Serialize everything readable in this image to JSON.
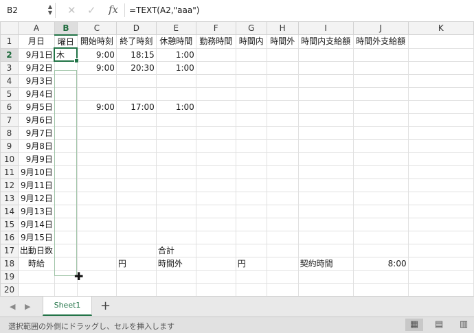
{
  "formula_bar": {
    "name_box": "B2",
    "cancel_icon": "close-icon",
    "enter_icon": "check-icon",
    "fx_label": "fx",
    "formula": "=TEXT(A2,\"aaa\")"
  },
  "columns": [
    "A",
    "B",
    "C",
    "D",
    "E",
    "F",
    "G",
    "H",
    "I",
    "J",
    "K"
  ],
  "selected_column": "B",
  "active_cell": "B2",
  "rows": [
    {
      "n": "1",
      "cells": [
        "月日",
        "曜日",
        "開始時刻",
        "終了時刻",
        "休憩時間",
        "勤務時間",
        "時間内",
        "時間外",
        "時間内支給額",
        "時間外支給額",
        ""
      ]
    },
    {
      "n": "2",
      "cells": [
        "9月1日",
        "木",
        "9:00",
        "18:15",
        "1:00",
        "",
        "",
        "",
        "",
        "",
        ""
      ]
    },
    {
      "n": "3",
      "cells": [
        "9月2日",
        "",
        "9:00",
        "20:30",
        "1:00",
        "",
        "",
        "",
        "",
        "",
        ""
      ]
    },
    {
      "n": "4",
      "cells": [
        "9月3日",
        "",
        "",
        "",
        "",
        "",
        "",
        "",
        "",
        "",
        ""
      ]
    },
    {
      "n": "5",
      "cells": [
        "9月4日",
        "",
        "",
        "",
        "",
        "",
        "",
        "",
        "",
        "",
        ""
      ]
    },
    {
      "n": "6",
      "cells": [
        "9月5日",
        "",
        "9:00",
        "17:00",
        "1:00",
        "",
        "",
        "",
        "",
        "",
        ""
      ]
    },
    {
      "n": "7",
      "cells": [
        "9月6日",
        "",
        "",
        "",
        "",
        "",
        "",
        "",
        "",
        "",
        ""
      ]
    },
    {
      "n": "8",
      "cells": [
        "9月7日",
        "",
        "",
        "",
        "",
        "",
        "",
        "",
        "",
        "",
        ""
      ]
    },
    {
      "n": "9",
      "cells": [
        "9月8日",
        "",
        "",
        "",
        "",
        "",
        "",
        "",
        "",
        "",
        ""
      ]
    },
    {
      "n": "10",
      "cells": [
        "9月9日",
        "",
        "",
        "",
        "",
        "",
        "",
        "",
        "",
        "",
        ""
      ]
    },
    {
      "n": "11",
      "cells": [
        "9月10日",
        "",
        "",
        "",
        "",
        "",
        "",
        "",
        "",
        "",
        ""
      ]
    },
    {
      "n": "12",
      "cells": [
        "9月11日",
        "",
        "",
        "",
        "",
        "",
        "",
        "",
        "",
        "",
        ""
      ]
    },
    {
      "n": "13",
      "cells": [
        "9月12日",
        "",
        "",
        "",
        "",
        "",
        "",
        "",
        "",
        "",
        ""
      ]
    },
    {
      "n": "14",
      "cells": [
        "9月13日",
        "",
        "",
        "",
        "",
        "",
        "",
        "",
        "",
        "",
        ""
      ]
    },
    {
      "n": "15",
      "cells": [
        "9月14日",
        "",
        "",
        "",
        "",
        "",
        "",
        "",
        "",
        "",
        ""
      ]
    },
    {
      "n": "16",
      "cells": [
        "9月15日",
        "",
        "",
        "",
        "",
        "",
        "",
        "",
        "",
        "",
        ""
      ]
    },
    {
      "n": "17",
      "cells": [
        "出動日数",
        "",
        "",
        "",
        "合計",
        "",
        "",
        "",
        "",
        "",
        ""
      ]
    },
    {
      "n": "18",
      "cells": [
        "時給",
        "",
        "",
        "円",
        "時間外",
        "",
        "円",
        "",
        "契約時間",
        "8:00",
        ""
      ]
    },
    {
      "n": "19",
      "cells": [
        "",
        "",
        "",
        "",
        "",
        "",
        "",
        "",
        "",
        "",
        ""
      ]
    },
    {
      "n": "20",
      "cells": [
        "",
        "",
        "",
        "",
        "",
        "",
        "",
        "",
        "",
        "",
        ""
      ]
    }
  ],
  "sheet_tabs": {
    "prev_icon": "triangle-left-icon",
    "next_icon": "triangle-right-icon",
    "active_tab": "Sheet1",
    "add_icon": "plus-icon"
  },
  "status_bar": {
    "message": "選択範囲の外側にドラッグし、セルを挿入します",
    "views": [
      "normal-view-icon",
      "page-layout-icon"
    ]
  },
  "colors": {
    "accent": "#217346",
    "header_bg": "#f3f3f3",
    "selection_border": "#9ec3a6"
  }
}
